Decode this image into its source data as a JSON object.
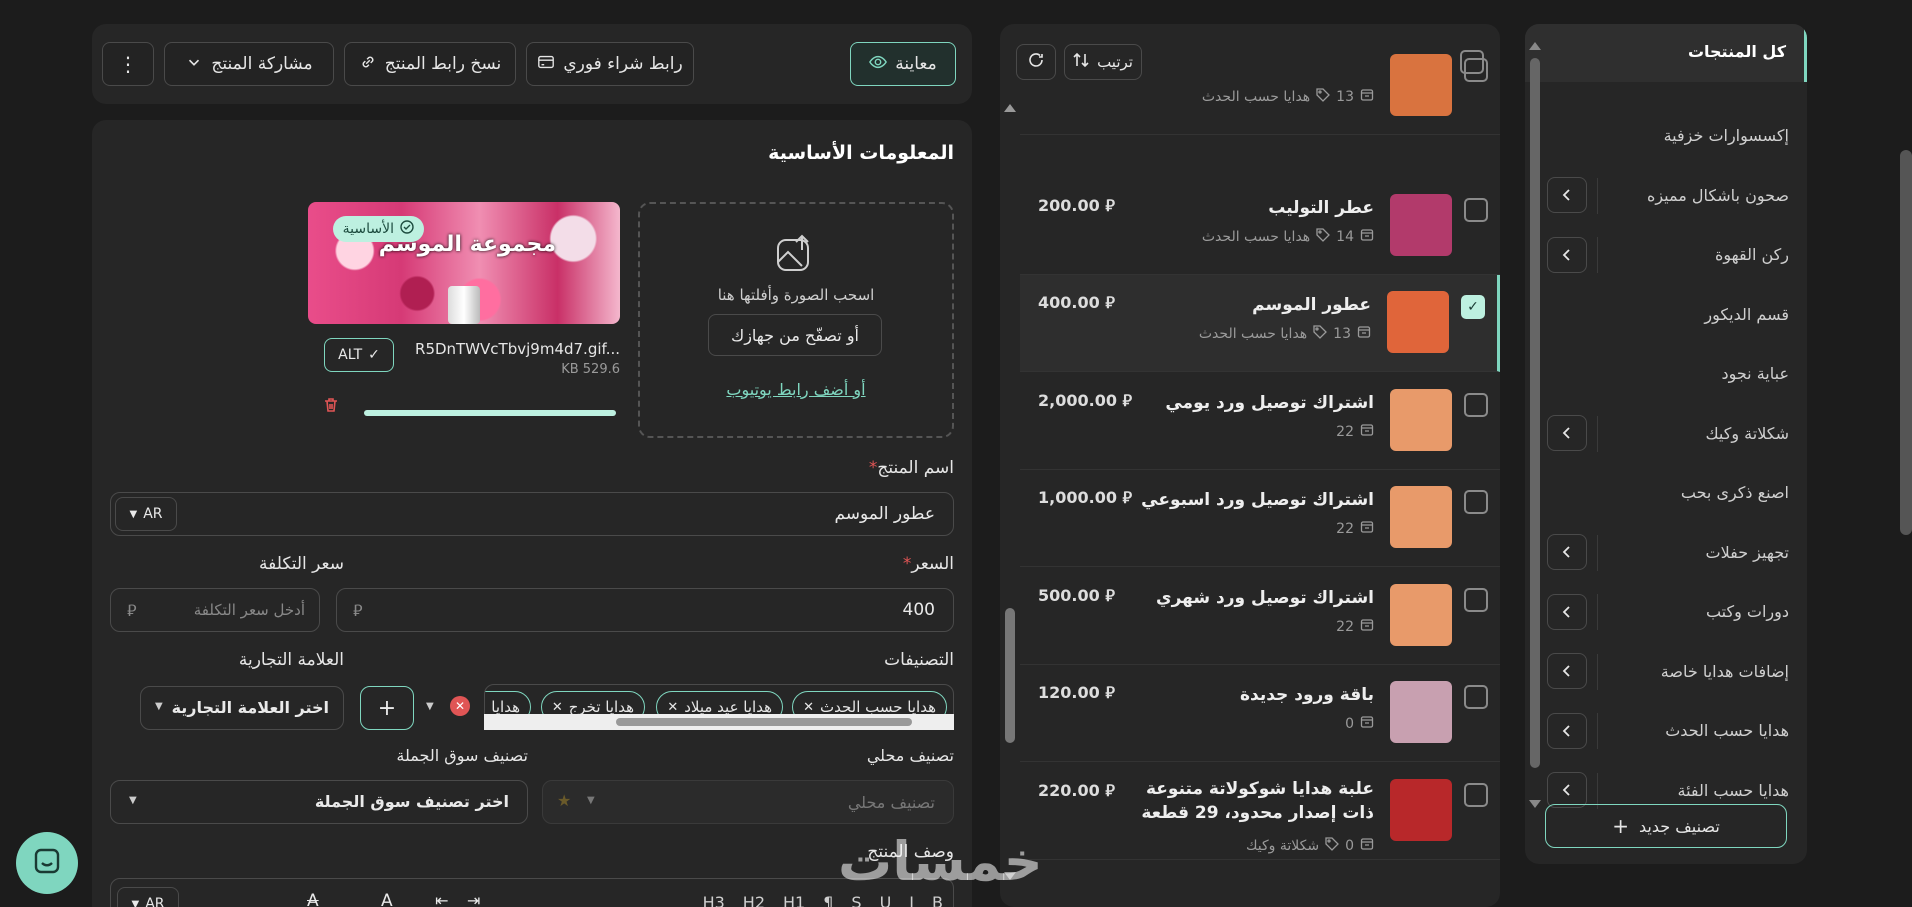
{
  "colors": {
    "bg": "#1c1c1c",
    "panel": "#262626",
    "accent": "#7fd6bf",
    "danger": "#e05555"
  },
  "toolbar": {
    "preview_label": "معاينة",
    "instant_link_label": "رابط شراء فوري",
    "copy_link_label": "نسخ رابط المنتج",
    "share_label": "مشاركة المنتج"
  },
  "basic_info": {
    "title": "المعلومات الأساسية",
    "upload_drag_text": "اسحب الصورة وأفلتها هنا",
    "upload_browse_label": "أو تصفّح من جهازك",
    "youtube_link_label": "أو أضف رابط يوتيوب",
    "image_primary_badge": "الأساسية",
    "image_banner_text": "مجموعة الموسم",
    "image_filename": "R5DnTWVcTbvj9m4d7.gif...",
    "image_size": "529.6 KB",
    "alt_label": "ALT",
    "upload_progress": 1.0
  },
  "form": {
    "name_label": "اسم المنتج",
    "name_value": "عطور الموسم",
    "lang_value": "AR",
    "price_label": "السعر",
    "price_value": "400",
    "cost_label": "سعر التكلفة",
    "cost_placeholder": "أدخل سعر التكلفة",
    "categories_label": "التصنيفات",
    "category_chips": [
      "هدايا حسب الحدث",
      "هدايا عيد ميلاد",
      "هدايا تخرج",
      "هدايا"
    ],
    "brand_label": "العلامة التجارية",
    "brand_placeholder": "اختر العلامة التجارية",
    "local_class_label": "تصنيف محلي",
    "local_class_placeholder": "تصنيف محلي",
    "wholesale_label": "تصنيف سوق الجملة",
    "wholesale_placeholder": "اختر تصنيف سوق الجملة",
    "description_label": "وصف المنتج",
    "editor_lang": "AR",
    "editor_tools": [
      "B",
      "I",
      "U",
      "S",
      "¶",
      "H1",
      "H2",
      "H3"
    ]
  },
  "product_list": {
    "sort_label": "ترتيب",
    "items": [
      {
        "name": "",
        "count": "13",
        "category": "هدايا حسب الحدث",
        "price": "",
        "checked": false,
        "thumb": "#d9733f"
      },
      {
        "name": "عطر التوليب",
        "count": "14",
        "category": "هدايا حسب الحدث",
        "price": "200.00",
        "checked": false,
        "thumb": "#b23a6b"
      },
      {
        "name": "عطور الموسم",
        "count": "13",
        "category": "هدايا حسب الحدث",
        "price": "400.00",
        "checked": true,
        "thumb": "#e0653a"
      },
      {
        "name": "اشتراك توصيل ورد يومي",
        "count": "22",
        "category": "",
        "price": "2,000.00",
        "checked": false,
        "thumb": "#e89a6a"
      },
      {
        "name": "اشتراك توصيل ورد اسبوعي",
        "count": "22",
        "category": "",
        "price": "1,000.00",
        "checked": false,
        "thumb": "#e89a6a"
      },
      {
        "name": "اشتراك توصيل ورد شهري",
        "count": "22",
        "category": "",
        "price": "500.00",
        "checked": false,
        "thumb": "#e89a6a"
      },
      {
        "name": "باقة ورود جديدة",
        "count": "0",
        "category": "",
        "price": "120.00",
        "checked": false,
        "thumb": "#c8a0b0"
      },
      {
        "name": "علبة هدايا شوكولاتة متنوعة ذات إصدار محدود، 29 قطعة",
        "count": "0",
        "category": "شكلاتة وكيك",
        "price": "220.00",
        "checked": false,
        "thumb": "#b8282a"
      }
    ]
  },
  "categories": {
    "all_label": "كل المنتجات",
    "items": [
      {
        "label": "إكسسوارات خزفية",
        "expandable": false
      },
      {
        "label": "صحون باشكال مميزه",
        "expandable": true
      },
      {
        "label": "ركن القهوة",
        "expandable": true
      },
      {
        "label": "قسم الديكور",
        "expandable": false
      },
      {
        "label": "عباية نجود",
        "expandable": false
      },
      {
        "label": "شكلاتة وكيك",
        "expandable": true
      },
      {
        "label": "اصنع ذكرى بحب",
        "expandable": false
      },
      {
        "label": "تجهيز حفلات",
        "expandable": true
      },
      {
        "label": "دورات وكتب",
        "expandable": true
      },
      {
        "label": "إضافات هدايا خاصة",
        "expandable": true
      },
      {
        "label": "هدايا حسب الحدث",
        "expandable": true
      },
      {
        "label": "هدايا حسب الفئة",
        "expandable": true
      }
    ],
    "new_category_label": "تصنيف جديد"
  },
  "watermark": "خمسات"
}
